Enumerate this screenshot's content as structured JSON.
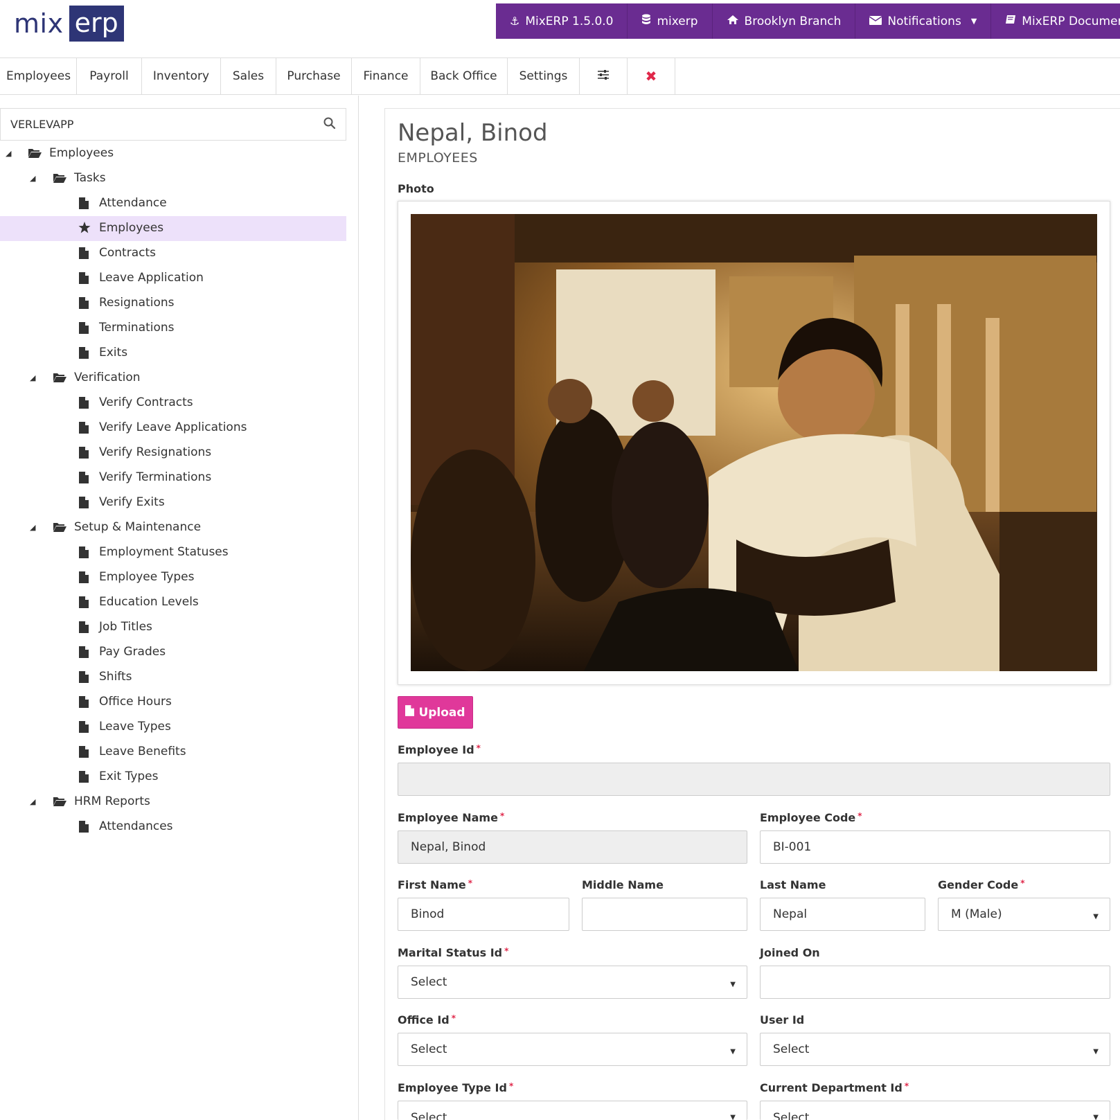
{
  "header": {
    "logo": {
      "part1": "mix",
      "part2": "erp"
    },
    "topbar": [
      {
        "icon": "anchor-icon",
        "label": "MixERP 1.5.0.0"
      },
      {
        "icon": "database-icon",
        "label": "mixerp"
      },
      {
        "icon": "home-icon",
        "label": "Brooklyn Branch"
      },
      {
        "icon": "envelope-icon",
        "label": "Notifications"
      },
      {
        "icon": "book-icon",
        "label": "MixERP Documentation"
      }
    ]
  },
  "tabs": [
    "Employees",
    "Payroll",
    "Inventory",
    "Sales",
    "Purchase",
    "Finance",
    "Back Office",
    "Settings"
  ],
  "sidebar": {
    "search": {
      "value": "VERLEVAPP"
    },
    "tree": {
      "root": "Employees",
      "tasks": {
        "label": "Tasks",
        "items": [
          "Attendance",
          "Employees",
          "Contracts",
          "Leave Application",
          "Resignations",
          "Terminations",
          "Exits"
        ]
      },
      "verification": {
        "label": "Verification",
        "items": [
          "Verify Contracts",
          "Verify Leave Applications",
          "Verify Resignations",
          "Verify Terminations",
          "Verify Exits"
        ]
      },
      "setup": {
        "label": "Setup & Maintenance",
        "items": [
          "Employment Statuses",
          "Employee Types",
          "Education Levels",
          "Job Titles",
          "Pay Grades",
          "Shifts",
          "Office Hours",
          "Leave Types",
          "Leave Benefits",
          "Exit Types"
        ]
      },
      "reports": {
        "label": "HRM Reports",
        "items": [
          "Attendances"
        ]
      }
    }
  },
  "form": {
    "title": "Nepal, Binod",
    "subtitle": "EMPLOYEES",
    "photo_label": "Photo",
    "upload_label": "Upload",
    "employee_id": {
      "label": "Employee Id",
      "value": ""
    },
    "employee_name": {
      "label": "Employee Name",
      "value": "Nepal, Binod"
    },
    "employee_code": {
      "label": "Employee Code",
      "value": "BI-001"
    },
    "first_name": {
      "label": "First Name",
      "value": "Binod"
    },
    "middle_name": {
      "label": "Middle Name",
      "value": ""
    },
    "last_name": {
      "label": "Last Name",
      "value": "Nepal"
    },
    "gender_code": {
      "label": "Gender Code",
      "value": "M (Male)"
    },
    "marital_status": {
      "label": "Marital Status Id",
      "value": "Select"
    },
    "joined_on": {
      "label": "Joined On",
      "value": ""
    },
    "office_id": {
      "label": "Office Id",
      "value": "Select"
    },
    "user_id": {
      "label": "User Id",
      "value": "Select"
    },
    "employee_type": {
      "label": "Employee Type Id",
      "value": "Select"
    },
    "current_department": {
      "label": "Current Department Id",
      "value": "Select"
    },
    "required_mark": "*"
  },
  "colors": {
    "brand_navy": "#2e3576",
    "topbar_purple": "#6a2c91",
    "active_row": "#ede1fa",
    "upload_pink": "#e0389a",
    "required_red": "#e0284a"
  }
}
